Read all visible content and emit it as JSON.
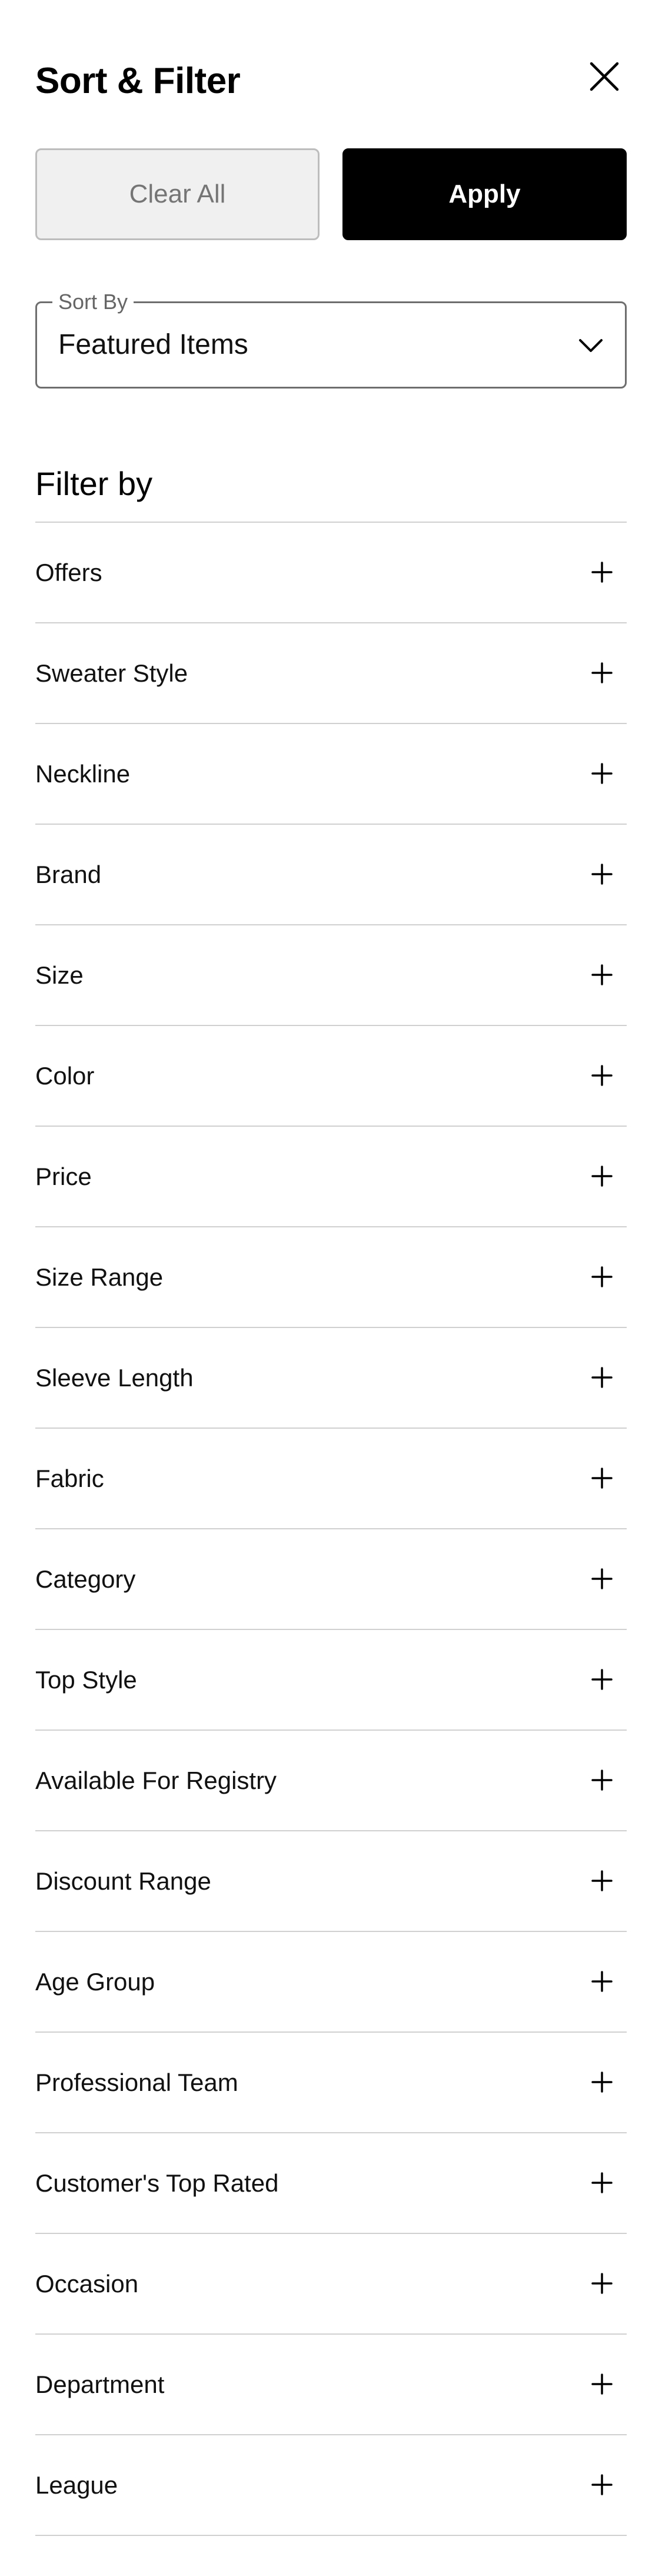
{
  "header": {
    "title": "Sort & Filter",
    "close_icon": "close-icon"
  },
  "actions": {
    "clear_label": "Clear All",
    "apply_label": "Apply"
  },
  "sort": {
    "label": "Sort By",
    "value": "Featured Items",
    "chevron_icon": "chevron-down-icon"
  },
  "filters": {
    "heading": "Filter by",
    "expand_icon": "plus-icon",
    "items": [
      {
        "label": "Offers"
      },
      {
        "label": "Sweater Style"
      },
      {
        "label": "Neckline"
      },
      {
        "label": "Brand"
      },
      {
        "label": "Size"
      },
      {
        "label": "Color"
      },
      {
        "label": "Price"
      },
      {
        "label": "Size Range"
      },
      {
        "label": "Sleeve Length"
      },
      {
        "label": "Fabric"
      },
      {
        "label": "Category"
      },
      {
        "label": "Top Style"
      },
      {
        "label": "Available For Registry"
      },
      {
        "label": "Discount Range"
      },
      {
        "label": "Age Group"
      },
      {
        "label": "Professional Team"
      },
      {
        "label": "Customer's Top Rated"
      },
      {
        "label": "Occasion"
      },
      {
        "label": "Department"
      },
      {
        "label": "League"
      }
    ]
  },
  "colors": {
    "apply_bg": "#000000",
    "clear_bg": "#f0f0f0",
    "divider": "#d0d0d0"
  }
}
